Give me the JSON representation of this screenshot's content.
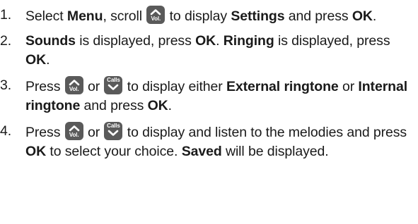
{
  "steps": [
    {
      "number": "1.",
      "parts": [
        {
          "t": "Select "
        },
        {
          "b": "Menu"
        },
        {
          "t": ", scroll "
        },
        {
          "icon": "up"
        },
        {
          "t": " to display "
        },
        {
          "b": "Settings"
        },
        {
          "t": " and press "
        },
        {
          "b": "OK"
        },
        {
          "t": "."
        }
      ]
    },
    {
      "number": "2.",
      "parts": [
        {
          "b": "Sounds"
        },
        {
          "t": " is displayed, press "
        },
        {
          "b": "OK"
        },
        {
          "t": ". "
        },
        {
          "b": "Ringing"
        },
        {
          "t": " is displayed, press "
        },
        {
          "b": "OK"
        },
        {
          "t": "."
        }
      ]
    },
    {
      "number": "3.",
      "parts": [
        {
          "t": "Press "
        },
        {
          "icon": "up"
        },
        {
          "t": " or "
        },
        {
          "icon": "down"
        },
        {
          "t": " to display either "
        },
        {
          "b": "External ringtone"
        },
        {
          "t": " or "
        },
        {
          "b": "Internal ringtone"
        },
        {
          "t": " and press "
        },
        {
          "b": "OK"
        },
        {
          "t": "."
        }
      ]
    },
    {
      "number": "4.",
      "parts": [
        {
          "t": "Press "
        },
        {
          "icon": "up"
        },
        {
          "t": " or "
        },
        {
          "icon": "down"
        },
        {
          "t": " to display and listen to the melodies and press "
        },
        {
          "b": "OK"
        },
        {
          "t": " to select your choice. "
        },
        {
          "b": "Saved"
        },
        {
          "t": " will be displayed."
        }
      ]
    }
  ],
  "icons": {
    "up": {
      "name": "up-vol-key-icon",
      "label": "Vol."
    },
    "down": {
      "name": "down-calls-key-icon",
      "label": "Calls"
    }
  }
}
